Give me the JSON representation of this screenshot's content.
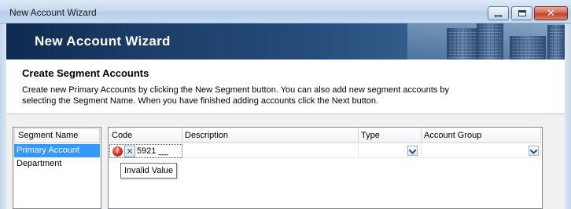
{
  "window": {
    "title": "New Account Wizard",
    "controls": {
      "minimize": "minimize",
      "maximize": "maximize",
      "close": "✕"
    }
  },
  "banner": {
    "title": "New Account Wizard"
  },
  "section": {
    "title": "Create Segment Accounts",
    "description": "Create new Primary Accounts by clicking the New Segment button. You can also add new segment accounts by selecting the Segment Name. When you have finished adding accounts click the Next button."
  },
  "segments": {
    "header": "Segment Name",
    "items": [
      {
        "label": "Primary Account",
        "selected": true
      },
      {
        "label": "Department",
        "selected": false
      }
    ]
  },
  "grid": {
    "columns": [
      "Code",
      "Description",
      "Type",
      "Account Group"
    ],
    "rows": [
      {
        "code": "5921 __",
        "description": "",
        "type": "",
        "account_group": ""
      }
    ],
    "error_icon": "error-icon",
    "clear_icon": "✕"
  },
  "tooltip": {
    "text": "Invalid Value"
  },
  "colors": {
    "selection": "#3399ff",
    "error": "#d4261c",
    "banner": "#1d3d68"
  }
}
